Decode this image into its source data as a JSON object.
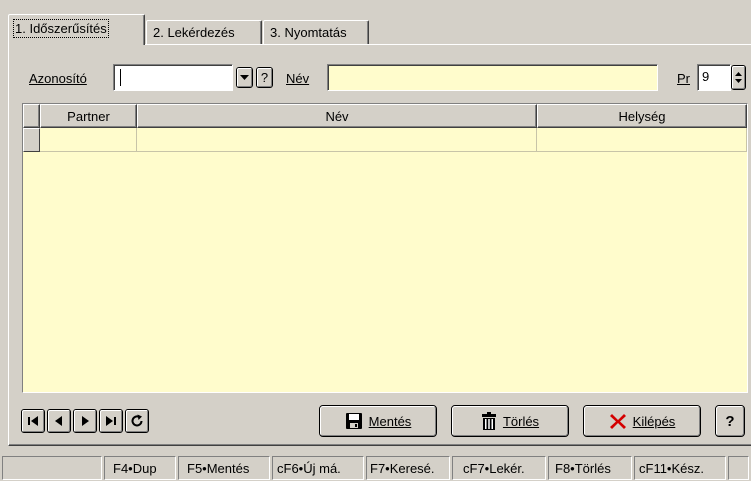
{
  "tabs": [
    {
      "label": "1. Időszerűsítés"
    },
    {
      "label": "2. Lekérdezés"
    },
    {
      "label": "3. Nyomtatás"
    }
  ],
  "filter": {
    "azonosito_label": "Azonosító",
    "azonosito_value": "",
    "help_symbol": "?",
    "nev_label": "Név",
    "nev_value": "",
    "pr_label": "Pr",
    "pr_value": "9"
  },
  "grid": {
    "columns": [
      "Partner",
      "Név",
      "Helység"
    ],
    "rows": [
      [
        "",
        "",
        ""
      ]
    ]
  },
  "buttons": {
    "save": "Mentés",
    "delete": "Törlés",
    "exit": "Kilépés",
    "help": "?"
  },
  "statusbar": [
    "F4•Dup",
    "F5•Mentés",
    "cF6•Új má.",
    "F7•Keresé.",
    "cF7•Lekér.",
    "F8•Törlés",
    "cF11•Kész."
  ]
}
